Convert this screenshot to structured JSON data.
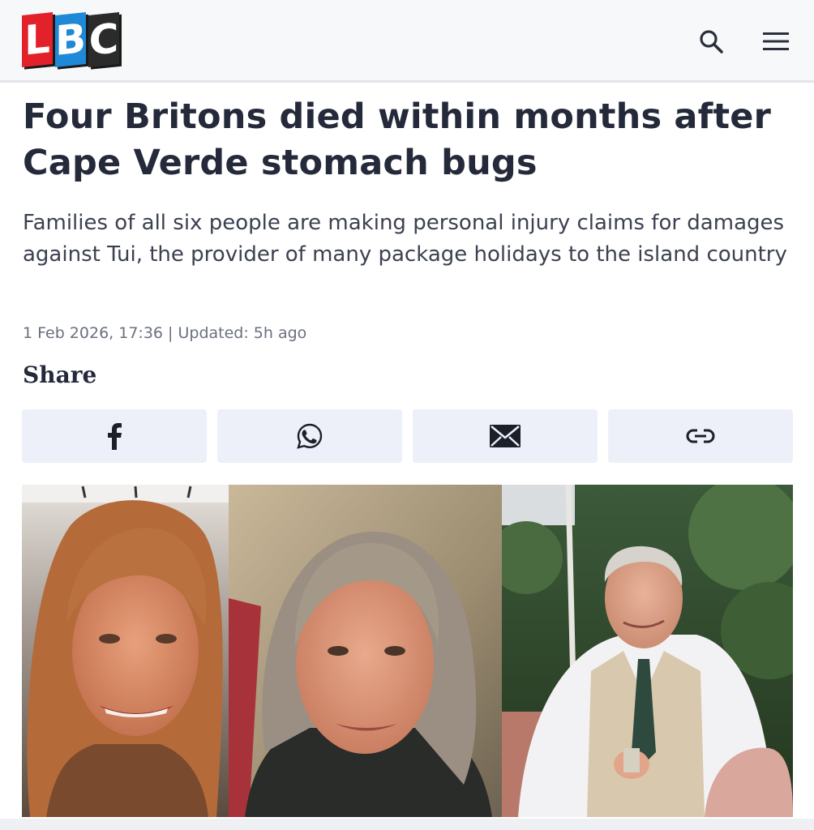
{
  "header": {
    "logo": {
      "letters": [
        "L",
        "B",
        "C"
      ],
      "colors": [
        "#e3212b",
        "#1f88d7",
        "#2b2b2b"
      ]
    },
    "icons": [
      "search-icon",
      "menu-icon"
    ]
  },
  "article": {
    "headline": "Four Britons died within months after Cape Verde stomach bugs",
    "standfirst": "Families of all six people are making personal injury claims for damages against Tui, the provider of many package holidays to the island country",
    "meta": "1 Feb 2026, 17:36 | Updated: 5h ago",
    "share_label": "Share",
    "share_buttons": [
      "facebook-icon",
      "whatsapp-icon",
      "email-icon",
      "link-icon"
    ]
  },
  "colors": {
    "header_bg": "#f7f8fa",
    "share_bg": "#edf0f8",
    "text": "#252a3b",
    "meta": "#6b7080"
  }
}
